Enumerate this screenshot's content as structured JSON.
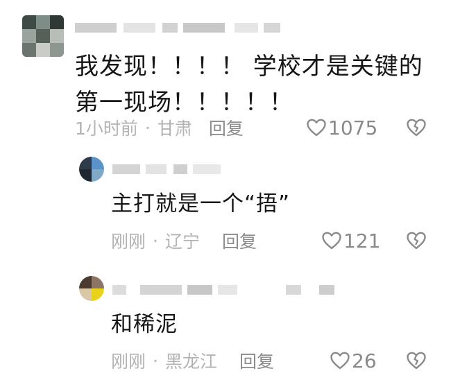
{
  "comments": [
    {
      "text_lines": [
        "我发现！！！！ 学校才是关键的",
        "第一现场！！！！！"
      ],
      "time": "1小时前",
      "dot": "·",
      "location": "甘肃",
      "reply_label": "回复",
      "likes": "1075",
      "like_icon": "heart-outline-icon",
      "dislike_icon": "broken-heart-icon"
    },
    {
      "text_lines": [
        "主打就是一个“捂”"
      ],
      "time": "刚刚",
      "dot": "·",
      "location": "辽宁",
      "reply_label": "回复",
      "likes": "121",
      "like_icon": "heart-outline-icon",
      "dislike_icon": "broken-heart-icon"
    },
    {
      "text_lines": [
        "和稀泥"
      ],
      "time": "刚刚",
      "dot": "·",
      "location": "黑龙江",
      "reply_label": "回复",
      "likes": "26",
      "like_icon": "heart-outline-icon",
      "dislike_icon": "broken-heart-icon"
    }
  ],
  "colors": {
    "text_primary": "#161616",
    "text_meta": "#b3b3b3",
    "text_action": "#8a8a8a",
    "background": "#ffffff"
  }
}
